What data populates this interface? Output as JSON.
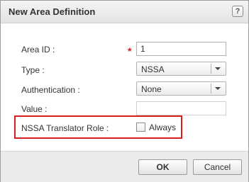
{
  "dialog": {
    "title": "New Area Definition",
    "help_label": "?"
  },
  "fields": {
    "area_id": {
      "label": "Area ID :",
      "required_marker": "*",
      "value": "1"
    },
    "type": {
      "label": "Type :",
      "selected": "NSSA"
    },
    "authentication": {
      "label": "Authentication :",
      "selected": "None"
    },
    "value": {
      "label": "Value :",
      "value": ""
    },
    "nssa_translator_role": {
      "label": "NSSA Translator Role :",
      "option_label": "Always",
      "checked": false
    }
  },
  "buttons": {
    "ok": "OK",
    "cancel": "Cancel"
  },
  "colors": {
    "required": "#d31e1e",
    "highlight_border": "#d71f1f"
  }
}
